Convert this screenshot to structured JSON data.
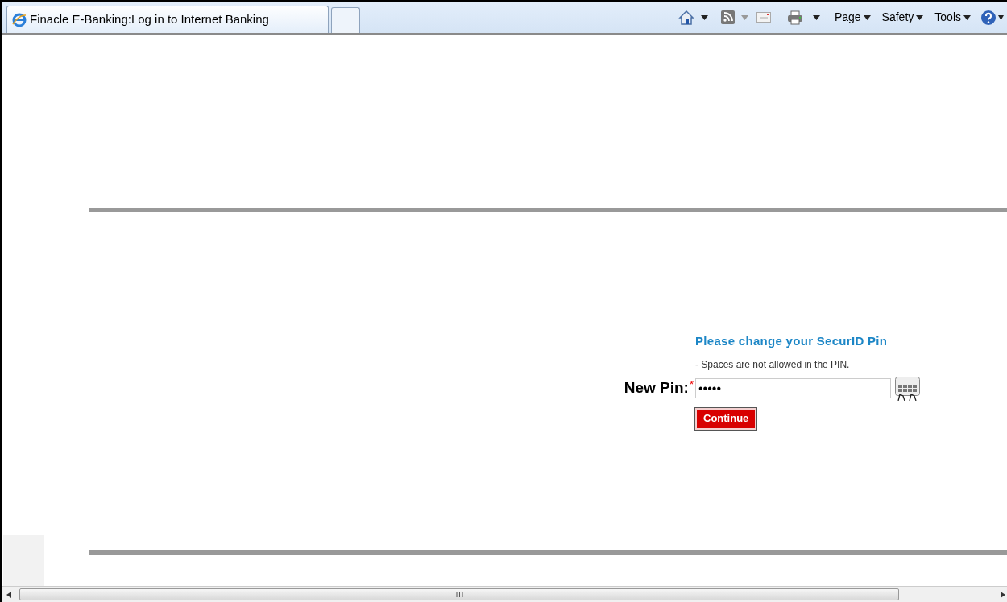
{
  "browser": {
    "tab": {
      "title": "Finacle E-Banking:Log in to Internet Banking",
      "selected": true
    },
    "toolbar": {
      "menus": [
        "Page",
        "Safety",
        "Tools"
      ]
    }
  },
  "form": {
    "heading": "Please change your SecurID Pin",
    "hint": "- Spaces are not allowed in the PIN.",
    "field": {
      "label": "New Pin:",
      "required": true,
      "required_mark": "*",
      "value": "•••••"
    },
    "button": "Continue"
  }
}
